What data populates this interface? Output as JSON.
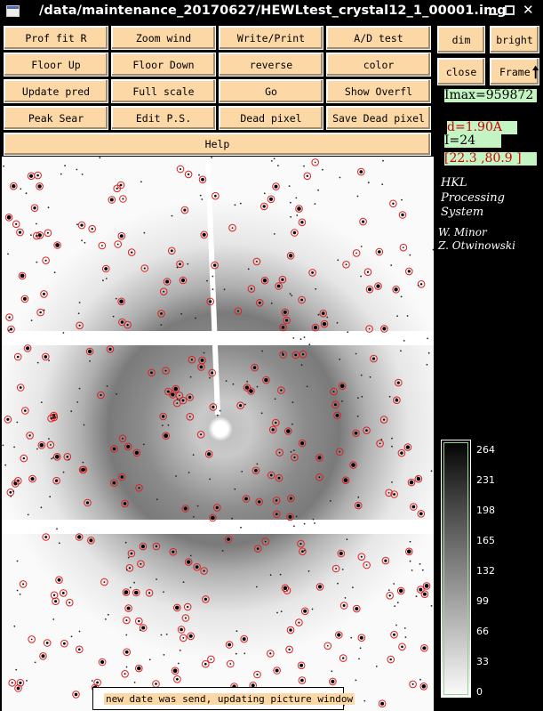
{
  "window": {
    "title": "/data/maintenance_20170627/HEWLtest_crystal12_1_00001.img"
  },
  "buttons": {
    "row1": [
      "Prof fit R",
      "Zoom wind",
      "Write/Print",
      "A/D test"
    ],
    "row2": [
      "Floor Up",
      "Floor Down",
      "reverse",
      "color"
    ],
    "row3": [
      "Update pred",
      "Full scale",
      "Go",
      "Show Overfl"
    ],
    "row4": [
      "Peak Sear",
      "Edit P.S.",
      "Dead pixel",
      "Save Dead pixel"
    ],
    "help": "Help",
    "side": {
      "dim": "dim",
      "bright": "bright",
      "close": "close",
      "frame": "Frame"
    }
  },
  "readouts": {
    "imax": "Imax=959872",
    "d": "d=1.90A",
    "intensity": "I=24",
    "coords": "[22.3 ,80.9 ]"
  },
  "colors": {
    "button_bg": "#fbd8a6",
    "readout_green": "#c4f4c4",
    "prediction_circle": "#e02020"
  },
  "branding": {
    "line1": "HKL",
    "line2": "Processing",
    "line3": "System",
    "author1": "W. Minor",
    "author2": "Z. Otwinowski"
  },
  "scale": {
    "ticks": [
      "264",
      "231",
      "198",
      "165",
      "132",
      "99",
      "66",
      "33",
      "0"
    ]
  },
  "status": {
    "message": "new date was send, updating picture window"
  },
  "icons": {
    "window": "app-icon",
    "minimize": "minimize-icon",
    "maximize": "maximize-icon",
    "close": "close-icon",
    "frame_arrow": "arrow-up-icon"
  }
}
